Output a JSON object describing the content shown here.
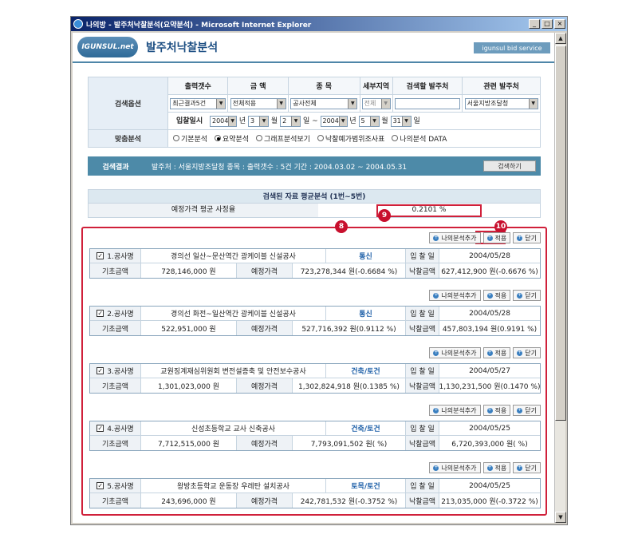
{
  "window": {
    "title": "나의방 - 발주처낙찰분석(요약분석) - Microsoft Internet Explorer",
    "min": "_",
    "max": "□",
    "close": "×"
  },
  "header": {
    "logo": "IGUNSUL.net",
    "title": "발주처낙찰분석",
    "service": "igunsul bid service"
  },
  "options": {
    "label": "검색옵션",
    "headers": [
      "출력갯수",
      "금 액",
      "종 목",
      "세부지역",
      "검색할 발주처",
      "관련 발주처"
    ],
    "values": [
      "최근결과5건",
      "전체적용",
      "공사전체",
      "전체",
      "",
      "서울지방조달청"
    ],
    "date_label": "입찰일시",
    "date_from": {
      "year": "2004",
      "y": "년",
      "month": "3",
      "m": "월",
      "day": "2",
      "d": "일 ~"
    },
    "date_to": {
      "year": "2004",
      "y": "년",
      "month": "5",
      "m": "월",
      "day": "31",
      "d": "일"
    },
    "analysis_label": "맞춤분석",
    "radios": [
      "기본분석",
      "요약분석",
      "그래프분석보기",
      "낙찰예가범위조사표",
      "나의분석 DATA"
    ]
  },
  "result": {
    "label": "검색결과",
    "info": "발주처 : 서울지방조달청  종목 :   출력갯수 : 5건  기간 : 2004.03.02 ~ 2004.05.31",
    "button": "검색하기"
  },
  "avg": {
    "title": "검색된 자료 평균분석 (1번~5번)",
    "label": "예정가격 평균 사정율",
    "value": "0.2101 %"
  },
  "badges": {
    "b8": "8",
    "b9": "9",
    "b10": "10"
  },
  "buttons": {
    "add": "나의분석추가",
    "apply": "적용",
    "close": "닫기"
  },
  "labels": {
    "base": "기초금액",
    "expected": "예정가격",
    "bid_date": "입 찰 일",
    "bid_amt": "낙찰금액"
  },
  "items": [
    {
      "no": "1.공사명",
      "name": "경의선 일산~문산역간 광케이블 신설공사",
      "cat": "통신",
      "date": "2004/05/28",
      "base": "728,146,000 원",
      "expected": "723,278,344 원(-0.6684 %)",
      "bid": "627,412,900 원(-0.6676 %)"
    },
    {
      "no": "2.공사명",
      "name": "경의선 화전~일산역간 광케이블 신설공사",
      "cat": "통신",
      "date": "2004/05/28",
      "base": "522,951,000 원",
      "expected": "527,716,392 원(0.9112 %)",
      "bid": "457,803,194 원(0.9191 %)"
    },
    {
      "no": "3.공사명",
      "name": "교원징계재심위원회 변전설증축 및 안전보수공사",
      "cat": "건축/토건",
      "date": "2004/05/27",
      "base": "1,301,023,000 원",
      "expected": "1,302,824,918 원(0.1385 %)",
      "bid": "1,130,231,500 원(0.1470 %)"
    },
    {
      "no": "4.공사명",
      "name": "신성초등학교 교사 신축공사",
      "cat": "건축/토건",
      "date": "2004/05/25",
      "base": "7,712,515,000 원",
      "expected": "7,793,091,502 원( %)",
      "bid": "6,720,393,000 원( %)"
    },
    {
      "no": "5.공사명",
      "name": "왕방초등학교 운동장 우레탄 설치공사",
      "cat": "토목/토건",
      "date": "2004/05/25",
      "base": "243,696,000 원",
      "expected": "242,781,532 원(-0.3752 %)",
      "bid": "213,035,000 원(-0.3722 %)"
    }
  ],
  "colors": {
    "accent": "#4d8aa8",
    "highlight": "#d0203a"
  }
}
